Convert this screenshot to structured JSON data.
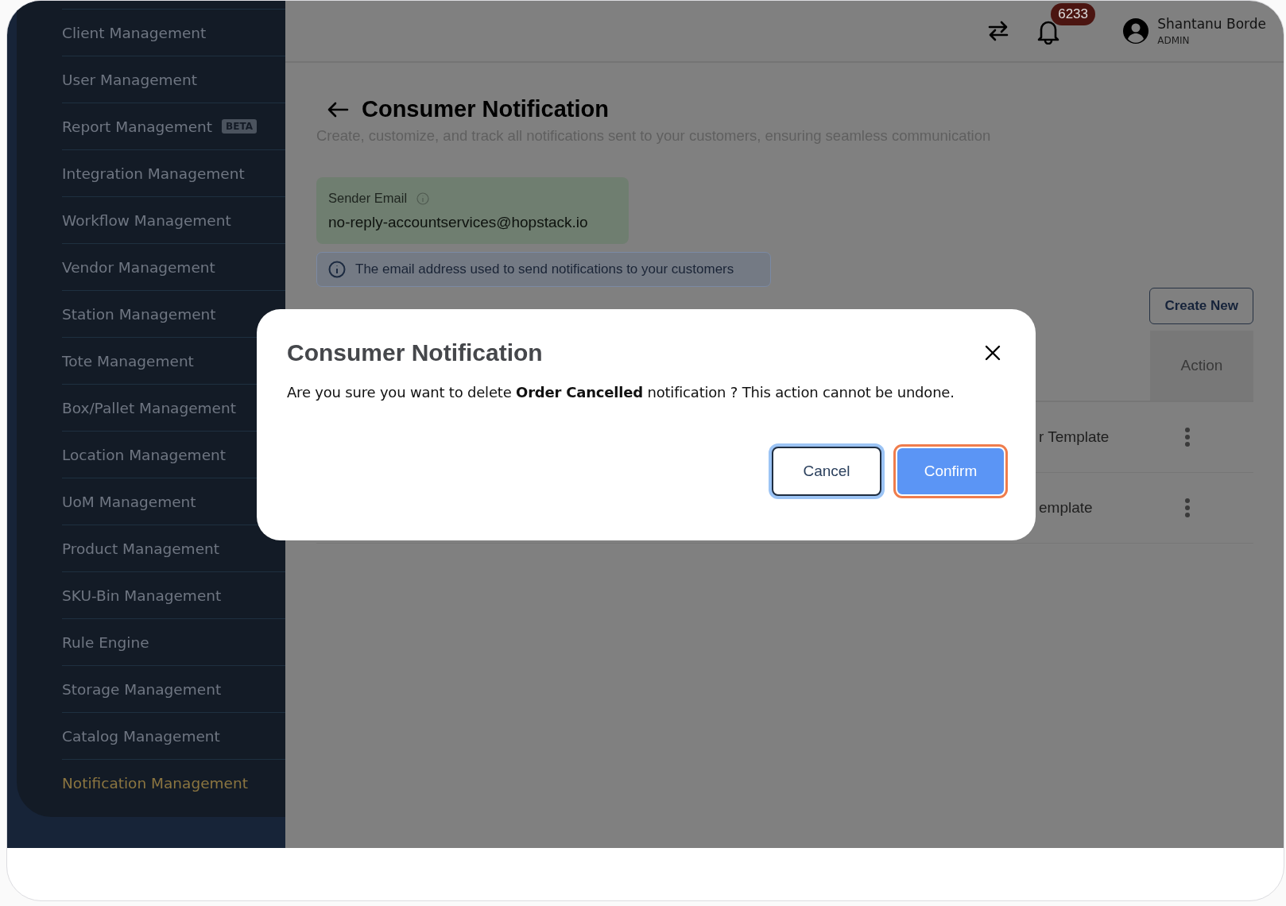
{
  "sidebar": {
    "items": [
      {
        "label": "Client Management",
        "selected": false
      },
      {
        "label": "User Management",
        "selected": false
      },
      {
        "label": "Report Management",
        "badge": "BETA",
        "selected": false
      },
      {
        "label": "Integration Management",
        "selected": false
      },
      {
        "label": "Workflow Management",
        "selected": false
      },
      {
        "label": "Vendor Management",
        "selected": false
      },
      {
        "label": "Station Management",
        "selected": false
      },
      {
        "label": "Tote Management",
        "selected": false
      },
      {
        "label": "Box/Pallet Management",
        "selected": false
      },
      {
        "label": "Location Management",
        "selected": false
      },
      {
        "label": "UoM Management",
        "selected": false
      },
      {
        "label": "Product Management",
        "selected": false
      },
      {
        "label": "SKU-Bin Management",
        "selected": false
      },
      {
        "label": "Rule Engine",
        "selected": false
      },
      {
        "label": "Storage Management",
        "selected": false
      },
      {
        "label": "Catalog Management",
        "selected": false
      },
      {
        "label": "Notification Management",
        "selected": true
      }
    ]
  },
  "header": {
    "notification_count": "6233",
    "user": {
      "name": "Shantanu Borde",
      "role": "ADMIN"
    }
  },
  "page": {
    "title": "Consumer Notification",
    "subtitle": "Create, customize, and track all notifications sent to your customers, ensuring seamless communication",
    "sender_email": {
      "label": "Sender Email",
      "value": "no-reply-accountservices@hopstack.io"
    },
    "info": "The email address used to send notifications to your customers",
    "create_button": "Create New",
    "table": {
      "columns": [
        "Action"
      ],
      "rows": [
        {
          "column_1": "r Template"
        },
        {
          "column_1": "emplate"
        }
      ]
    }
  },
  "dialog": {
    "title": "Consumer Notification",
    "message": "Are you sure you want to delete **Order Cancelled** notification ? This action cannot be undone.",
    "buttons": [
      {
        "label": "Cancel",
        "kind": "secondary"
      },
      {
        "label": "Confirm",
        "kind": "primary"
      }
    ]
  }
}
